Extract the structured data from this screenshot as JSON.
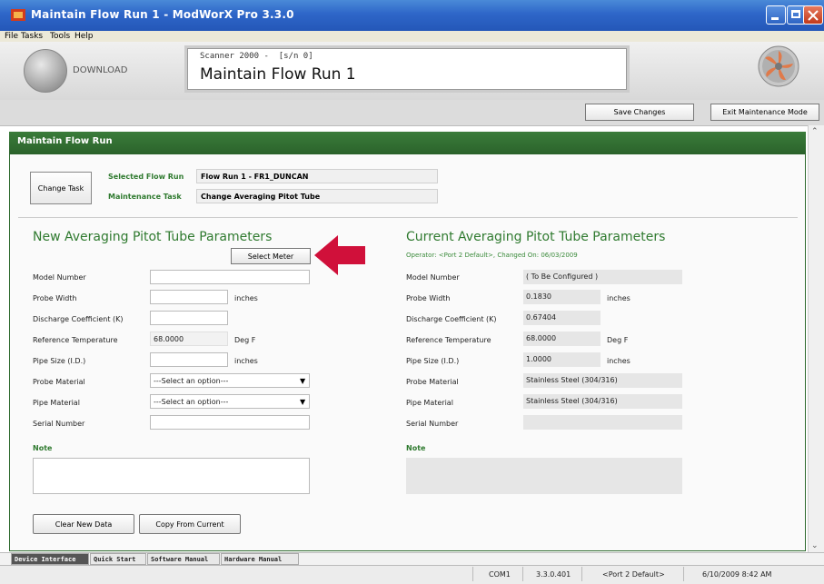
{
  "window": {
    "title": "Maintain Flow Run 1 - ModWorX Pro 3.3.0"
  },
  "menu": [
    "File",
    "Tasks",
    "Tools",
    "Help"
  ],
  "header": {
    "download_label": "DOWNLOAD",
    "scanner_text": "Scanner 2000 -  [s/n 0]",
    "title": "Maintain Flow Run 1"
  },
  "toolbar": {
    "save_label": "Save Changes",
    "exit_label": "Exit Maintenance Mode"
  },
  "panel": {
    "title": "Maintain Flow Run"
  },
  "task": {
    "change_task_label": "Change Task",
    "selected_flow_run_label": "Selected Flow Run",
    "selected_flow_run_value": "Flow Run 1 - FR1_DUNCAN",
    "maintenance_task_label": "Maintenance Task",
    "maintenance_task_value": "Change Averaging Pitot Tube"
  },
  "new_params": {
    "title": "New Averaging Pitot Tube Parameters",
    "select_meter_label": "Select Meter",
    "labels": [
      "Model Number",
      "Probe Width",
      "Discharge Coefficient (K)",
      "Reference Temperature",
      "Pipe Size (I.D.)",
      "Probe Material",
      "Pipe Material",
      "Serial Number"
    ],
    "reference_temperature_value": "68.0000",
    "unit_inches": "inches",
    "unit_degf": "Deg F",
    "probe_material_placeholder": "---Select an option---",
    "pipe_material_placeholder": "---Select an option---",
    "note_label": "Note",
    "clear_label": "Clear New Data",
    "copy_label": "Copy From Current"
  },
  "current_params": {
    "title": "Current Averaging Pitot Tube Parameters",
    "subtitle": "Operator: <Port 2 Default>, Changed On: 06/03/2009",
    "labels": [
      "Model Number",
      "Probe Width",
      "Discharge Coefficient (K)",
      "Reference Temperature",
      "Pipe Size (I.D.)",
      "Probe Material",
      "Pipe Material",
      "Serial Number"
    ],
    "model_number": "( To Be Configured )",
    "probe_width": "0.1830",
    "discharge_coefficient": "0.67404",
    "reference_temperature": "68.0000",
    "pipe_size": "1.0000",
    "probe_material": "Stainless Steel (304/316)",
    "pipe_material": "Stainless Steel (304/316)",
    "unit_inches": "inches",
    "unit_degf": "Deg F",
    "note_label": "Note"
  },
  "tabs": [
    "Device Interface",
    "Quick Start",
    "Software Manual",
    "Hardware Manual"
  ],
  "status": {
    "port": "COM1",
    "version": "3.3.0.401",
    "operator": "<Port 2 Default>",
    "datetime": "6/10/2009 8:42 AM"
  },
  "colors": {
    "accent_green": "#2f7a2f",
    "title_blue": "#2e66c8",
    "arrow_red": "#d0103a"
  }
}
